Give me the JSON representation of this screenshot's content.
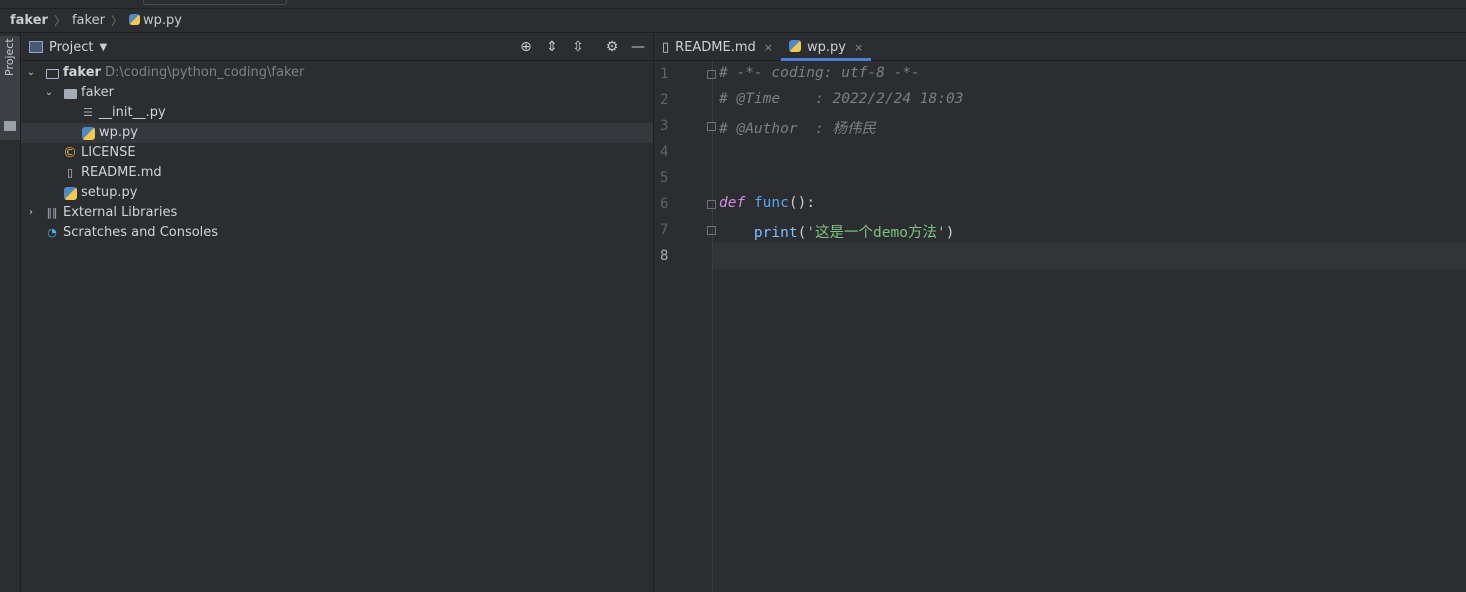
{
  "breadcrumb": [
    "faker",
    "faker",
    "wp.py"
  ],
  "project_panel": {
    "title": "Project",
    "tree": [
      {
        "label": "faker",
        "path": "D:\\coding\\python_coding\\faker"
      },
      {
        "label": "faker"
      },
      {
        "label": "__init__.py"
      },
      {
        "label": "wp.py"
      },
      {
        "label": "LICENSE"
      },
      {
        "label": "README.md"
      },
      {
        "label": "setup.py"
      },
      {
        "label": "External Libraries"
      },
      {
        "label": "Scratches and Consoles"
      }
    ]
  },
  "sidebar_tab": "Project",
  "tabs": [
    {
      "label": "README.md",
      "close": "×"
    },
    {
      "label": "wp.py",
      "close": "×"
    }
  ],
  "editor": {
    "line_numbers": [
      "1",
      "2",
      "3",
      "4",
      "5",
      "6",
      "7",
      "8"
    ],
    "lines": {
      "l1": "# -*- coding: utf-8 -*-",
      "l2": "# @Time    : 2022/2/24 18:03",
      "l3": "# @Author  : 杨伟民",
      "l6_kw": "def",
      "l6_fn": "func",
      "l6_rest": "():",
      "l7_bi": "print",
      "l7_open": "(",
      "l7_str": "'这是一个demo方法'",
      "l7_close": ")"
    }
  },
  "colors": {
    "accent": "#4d7dd6",
    "keyword": "#cf8ee0",
    "function": "#59a8f2",
    "string": "#7fc27f",
    "comment": "#7b7f86"
  }
}
